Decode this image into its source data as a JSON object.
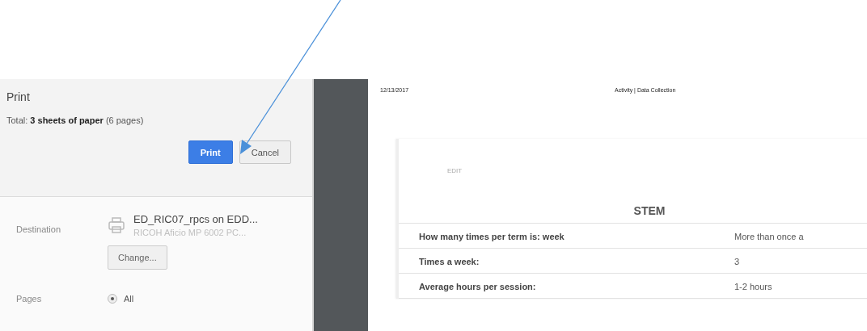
{
  "print_panel": {
    "title": "Print",
    "total": "Total: **3 sheets of paper** (6 pages)",
    "buttons": [
      {
        "label": "Print",
        "kind": "primary"
      },
      {
        "label": "Cancel",
        "kind": "secondary"
      }
    ],
    "destination": {
      "label": "Destination",
      "printer_name": "ED_RIC07_rpcs on EDD...",
      "printer_model": "RICOH Aficio MP 6002 PC...",
      "change_button": "Change..."
    },
    "pages": {
      "label": "Pages",
      "options": [
        {
          "label": "All",
          "selected": true
        }
      ]
    }
  },
  "preview": {
    "header_date": "12/13/2017",
    "header_title": "Activity | Data Collection",
    "card": {
      "edit_link": "EDIT",
      "section_title": "STEM",
      "rows": [
        {
          "question": "How many times per term is: week",
          "answer": "More than once a"
        },
        {
          "question": "Times a week:",
          "answer": "3"
        },
        {
          "question": "Average hours per session:",
          "answer": "1-2 hours"
        }
      ]
    }
  }
}
